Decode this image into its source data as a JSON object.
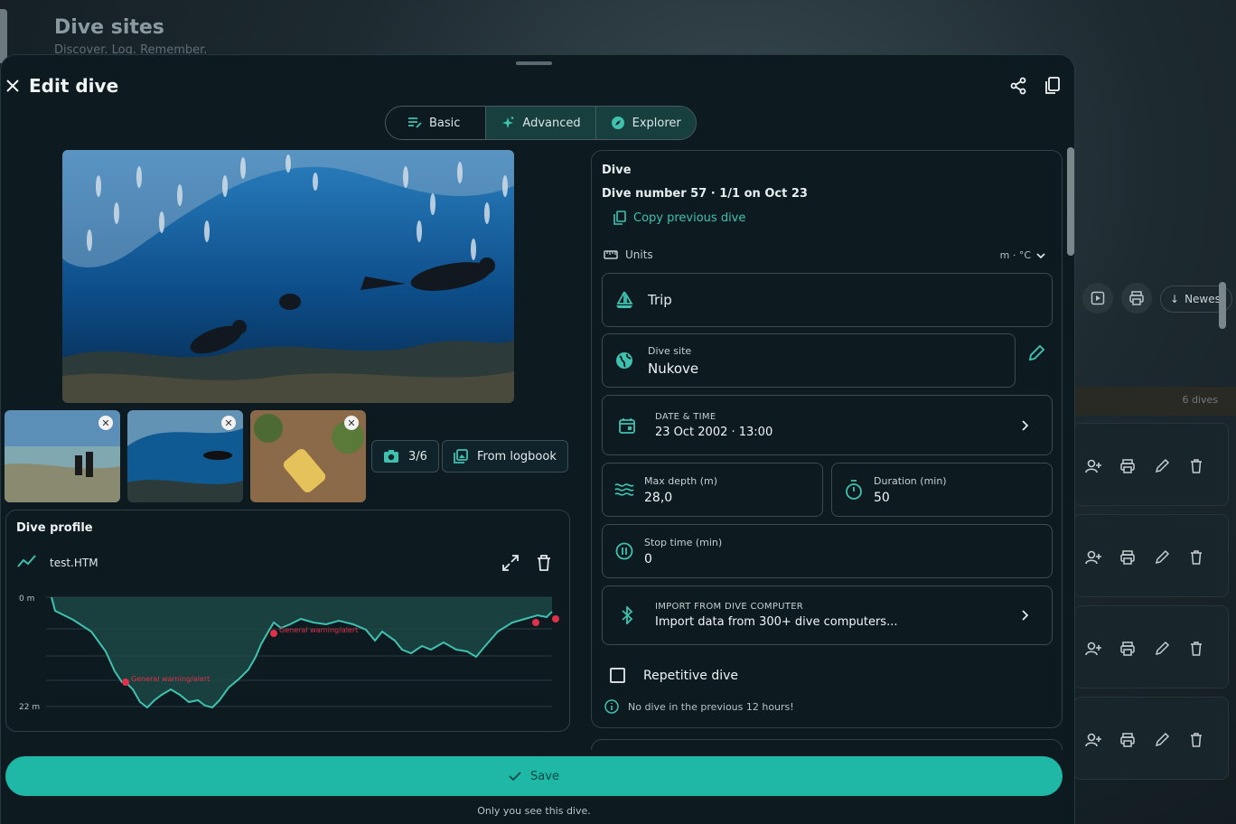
{
  "background": {
    "title": "Dive sites",
    "subtitle": "Discover. Log. Remember.",
    "sort_label": "Newest",
    "count_label": "6 dives"
  },
  "sheet": {
    "title": "Edit dive",
    "tabs": [
      {
        "label": "Basic",
        "icon": "lines-icon",
        "active": false
      },
      {
        "label": "Advanced",
        "icon": "sparkle-icon",
        "active": true
      },
      {
        "label": "Explorer",
        "icon": "compass-icon",
        "active": true
      }
    ]
  },
  "photos": {
    "counter": "3/6",
    "from_logbook": "From logbook"
  },
  "profile": {
    "title": "Dive profile",
    "file": "test.HTM",
    "axis_top": "0 m",
    "axis_bottom": "22 m",
    "alerts": [
      "General warning/alert",
      "General warning/alert"
    ]
  },
  "dive": {
    "section_title": "Dive",
    "number_line": "Dive number 57  ·  1/1 on Oct 23",
    "copy_previous": "Copy previous dive",
    "units_label": "Units",
    "units_value": "m · °C",
    "trip_label": "Trip",
    "site_label": "Dive site",
    "site_value": "Nukove",
    "datetime_caption": "DATE & TIME",
    "datetime_value": "23 Oct 2002 · 13:00",
    "max_depth_label": "Max depth (m)",
    "max_depth_value": "28,0",
    "duration_label": "Duration (min)",
    "duration_value": "50",
    "stop_label": "Stop time (min)",
    "stop_value": "0",
    "import_caption": "IMPORT FROM DIVE COMPUTER",
    "import_value": "Import data from 300+ dive computers...",
    "repetitive_label": "Repetitive dive",
    "repetitive_checked": false,
    "info_text": "No dive in the previous 12 hours!"
  },
  "footer": {
    "save_label": "Save",
    "privacy_note": "Only you see this dive."
  },
  "colors": {
    "accent": "#1fb8a6",
    "accent_text": "#3fc1b0",
    "alert": "#e0304a"
  }
}
